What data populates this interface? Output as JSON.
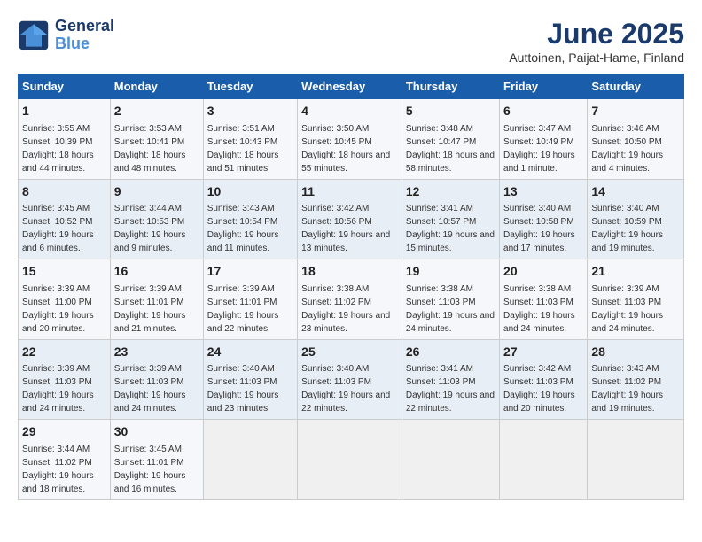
{
  "logo": {
    "line1": "General",
    "line2": "Blue"
  },
  "title": "June 2025",
  "subtitle": "Auttoinen, Paijat-Hame, Finland",
  "headers": [
    "Sunday",
    "Monday",
    "Tuesday",
    "Wednesday",
    "Thursday",
    "Friday",
    "Saturday"
  ],
  "weeks": [
    [
      {
        "day": "1",
        "sunrise": "3:55 AM",
        "sunset": "10:39 PM",
        "daylight": "18 hours and 44 minutes."
      },
      {
        "day": "2",
        "sunrise": "3:53 AM",
        "sunset": "10:41 PM",
        "daylight": "18 hours and 48 minutes."
      },
      {
        "day": "3",
        "sunrise": "3:51 AM",
        "sunset": "10:43 PM",
        "daylight": "18 hours and 51 minutes."
      },
      {
        "day": "4",
        "sunrise": "3:50 AM",
        "sunset": "10:45 PM",
        "daylight": "18 hours and 55 minutes."
      },
      {
        "day": "5",
        "sunrise": "3:48 AM",
        "sunset": "10:47 PM",
        "daylight": "18 hours and 58 minutes."
      },
      {
        "day": "6",
        "sunrise": "3:47 AM",
        "sunset": "10:49 PM",
        "daylight": "19 hours and 1 minute."
      },
      {
        "day": "7",
        "sunrise": "3:46 AM",
        "sunset": "10:50 PM",
        "daylight": "19 hours and 4 minutes."
      }
    ],
    [
      {
        "day": "8",
        "sunrise": "3:45 AM",
        "sunset": "10:52 PM",
        "daylight": "19 hours and 6 minutes."
      },
      {
        "day": "9",
        "sunrise": "3:44 AM",
        "sunset": "10:53 PM",
        "daylight": "19 hours and 9 minutes."
      },
      {
        "day": "10",
        "sunrise": "3:43 AM",
        "sunset": "10:54 PM",
        "daylight": "19 hours and 11 minutes."
      },
      {
        "day": "11",
        "sunrise": "3:42 AM",
        "sunset": "10:56 PM",
        "daylight": "19 hours and 13 minutes."
      },
      {
        "day": "12",
        "sunrise": "3:41 AM",
        "sunset": "10:57 PM",
        "daylight": "19 hours and 15 minutes."
      },
      {
        "day": "13",
        "sunrise": "3:40 AM",
        "sunset": "10:58 PM",
        "daylight": "19 hours and 17 minutes."
      },
      {
        "day": "14",
        "sunrise": "3:40 AM",
        "sunset": "10:59 PM",
        "daylight": "19 hours and 19 minutes."
      }
    ],
    [
      {
        "day": "15",
        "sunrise": "3:39 AM",
        "sunset": "11:00 PM",
        "daylight": "19 hours and 20 minutes."
      },
      {
        "day": "16",
        "sunrise": "3:39 AM",
        "sunset": "11:01 PM",
        "daylight": "19 hours and 21 minutes."
      },
      {
        "day": "17",
        "sunrise": "3:39 AM",
        "sunset": "11:01 PM",
        "daylight": "19 hours and 22 minutes."
      },
      {
        "day": "18",
        "sunrise": "3:38 AM",
        "sunset": "11:02 PM",
        "daylight": "19 hours and 23 minutes."
      },
      {
        "day": "19",
        "sunrise": "3:38 AM",
        "sunset": "11:03 PM",
        "daylight": "19 hours and 24 minutes."
      },
      {
        "day": "20",
        "sunrise": "3:38 AM",
        "sunset": "11:03 PM",
        "daylight": "19 hours and 24 minutes."
      },
      {
        "day": "21",
        "sunrise": "3:39 AM",
        "sunset": "11:03 PM",
        "daylight": "19 hours and 24 minutes."
      }
    ],
    [
      {
        "day": "22",
        "sunrise": "3:39 AM",
        "sunset": "11:03 PM",
        "daylight": "19 hours and 24 minutes."
      },
      {
        "day": "23",
        "sunrise": "3:39 AM",
        "sunset": "11:03 PM",
        "daylight": "19 hours and 24 minutes."
      },
      {
        "day": "24",
        "sunrise": "3:40 AM",
        "sunset": "11:03 PM",
        "daylight": "19 hours and 23 minutes."
      },
      {
        "day": "25",
        "sunrise": "3:40 AM",
        "sunset": "11:03 PM",
        "daylight": "19 hours and 22 minutes."
      },
      {
        "day": "26",
        "sunrise": "3:41 AM",
        "sunset": "11:03 PM",
        "daylight": "19 hours and 22 minutes."
      },
      {
        "day": "27",
        "sunrise": "3:42 AM",
        "sunset": "11:03 PM",
        "daylight": "19 hours and 20 minutes."
      },
      {
        "day": "28",
        "sunrise": "3:43 AM",
        "sunset": "11:02 PM",
        "daylight": "19 hours and 19 minutes."
      }
    ],
    [
      {
        "day": "29",
        "sunrise": "3:44 AM",
        "sunset": "11:02 PM",
        "daylight": "19 hours and 18 minutes."
      },
      {
        "day": "30",
        "sunrise": "3:45 AM",
        "sunset": "11:01 PM",
        "daylight": "19 hours and 16 minutes."
      },
      null,
      null,
      null,
      null,
      null
    ]
  ],
  "labels": {
    "sunrise": "Sunrise: ",
    "sunset": "Sunset: ",
    "daylight": "Daylight: "
  }
}
